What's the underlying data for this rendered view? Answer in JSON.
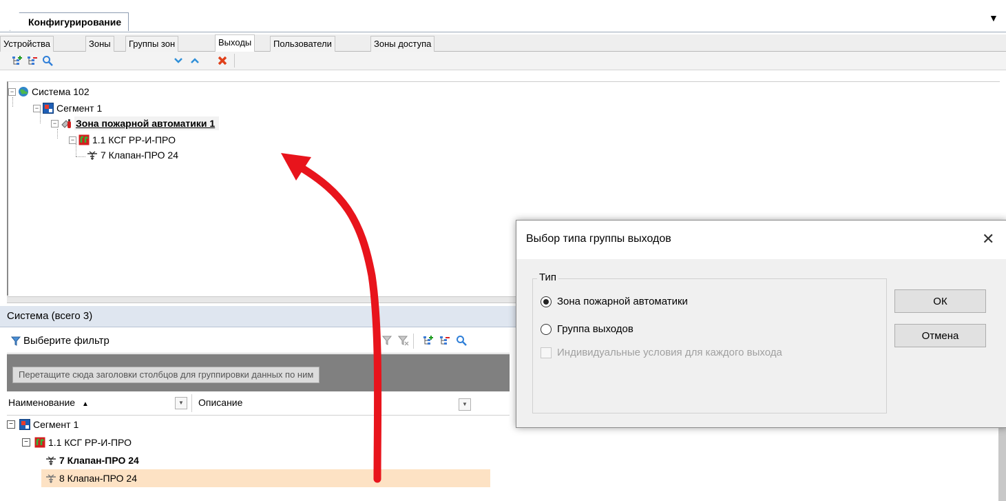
{
  "panel": {
    "title": "Конфигурирование",
    "menu_glyph": "▼"
  },
  "tabs": [
    "Устройства",
    "Зоны",
    "Группы зон",
    "Выходы",
    "Пользователи",
    "Зоны доступа"
  ],
  "active_tab": "Выходы",
  "toolbar": {
    "icons": [
      "expand-all-icon",
      "collapse-all-icon",
      "search-icon",
      "down-arrow-icon",
      "up-arrow-icon",
      "delete-icon"
    ]
  },
  "tree": {
    "system": "Система 102",
    "segment": "Сегмент 1",
    "zone": "Зона пожарной автоматики 1",
    "device": "1.1 КСГ РР-И-ПРО",
    "output": "7 Клапан-ПРО 24"
  },
  "system_bar": {
    "label": "Система (всего 3)"
  },
  "filter": {
    "label": "Выберите фильтр"
  },
  "group_area": {
    "hint": "Перетащите сюда заголовки столбцов для группировки данных по ним"
  },
  "columns": {
    "name": "Наименование",
    "sort_glyph": "▲",
    "description": "Описание"
  },
  "grid_rows": [
    {
      "label": "Сегмент 1"
    },
    {
      "label": "1.1 КСГ РР-И-ПРО"
    },
    {
      "label": "7 Клапан-ПРО 24"
    },
    {
      "label": "8 Клапан-ПРО 24"
    }
  ],
  "dialog": {
    "title": "Выбор типа группы выходов",
    "close_glyph": "✕",
    "group_label": "Тип",
    "option1": "Зона пожарной автоматики",
    "option2": "Группа выходов",
    "selected_option": "Зона пожарной автоматики",
    "checkbox_label": "Индивидуальные условия для каждого выхода",
    "checkbox_checked": false,
    "checkbox_enabled": false,
    "ok": "ОК",
    "cancel": "Отмена"
  },
  "colors": {
    "accent_arrow": "#e8141c",
    "highlight_row": "#fde2c4",
    "system_bar": "#dfe6f0"
  }
}
